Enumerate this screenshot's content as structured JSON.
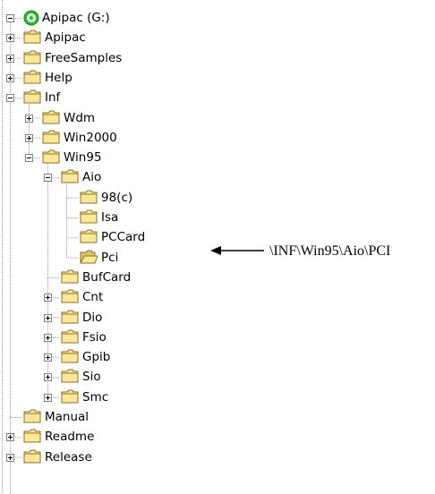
{
  "tree": {
    "root": {
      "label": "Apipac (G:)",
      "icon": "cd-drive-icon"
    },
    "items": [
      {
        "label": "Apipac",
        "level": 1,
        "expander": "plus",
        "open": false
      },
      {
        "label": "FreeSamples",
        "level": 1,
        "expander": "plus",
        "open": false
      },
      {
        "label": "Help",
        "level": 1,
        "expander": "plus",
        "open": false
      },
      {
        "label": "Inf",
        "level": 1,
        "expander": "minus",
        "open": false
      },
      {
        "label": "Wdm",
        "level": 2,
        "expander": "plus",
        "open": false
      },
      {
        "label": "Win2000",
        "level": 2,
        "expander": "plus",
        "open": false
      },
      {
        "label": "Win95",
        "level": 2,
        "expander": "minus",
        "open": false
      },
      {
        "label": "Aio",
        "level": 3,
        "expander": "minus",
        "open": false
      },
      {
        "label": "98(c)",
        "level": 4,
        "expander": "none",
        "open": false
      },
      {
        "label": "Isa",
        "level": 4,
        "expander": "none",
        "open": false
      },
      {
        "label": "PCCard",
        "level": 4,
        "expander": "none",
        "open": false
      },
      {
        "label": "Pci",
        "level": 4,
        "expander": "none",
        "open": true
      },
      {
        "label": "BufCard",
        "level": 3,
        "expander": "none",
        "open": false
      },
      {
        "label": "Cnt",
        "level": 3,
        "expander": "plus",
        "open": false
      },
      {
        "label": "Dio",
        "level": 3,
        "expander": "plus",
        "open": false
      },
      {
        "label": "Fsio",
        "level": 3,
        "expander": "plus",
        "open": false
      },
      {
        "label": "Gpib",
        "level": 3,
        "expander": "plus",
        "open": false
      },
      {
        "label": "Sio",
        "level": 3,
        "expander": "plus",
        "open": false
      },
      {
        "label": "Smc",
        "level": 3,
        "expander": "plus",
        "open": false
      },
      {
        "label": "Manual",
        "level": 1,
        "expander": "none",
        "open": false
      },
      {
        "label": "Readme",
        "level": 1,
        "expander": "plus",
        "open": false
      },
      {
        "label": "Release",
        "level": 1,
        "expander": "plus",
        "open": false
      }
    ]
  },
  "annotation": {
    "text": "\\INF\\Win95\\Aio\\PCI",
    "target": "Pci"
  },
  "colors": {
    "folder_fill": "#ffe79a",
    "folder_edge": "#8a7028",
    "line": "#9a9a9a",
    "drive": "#22c42a"
  }
}
